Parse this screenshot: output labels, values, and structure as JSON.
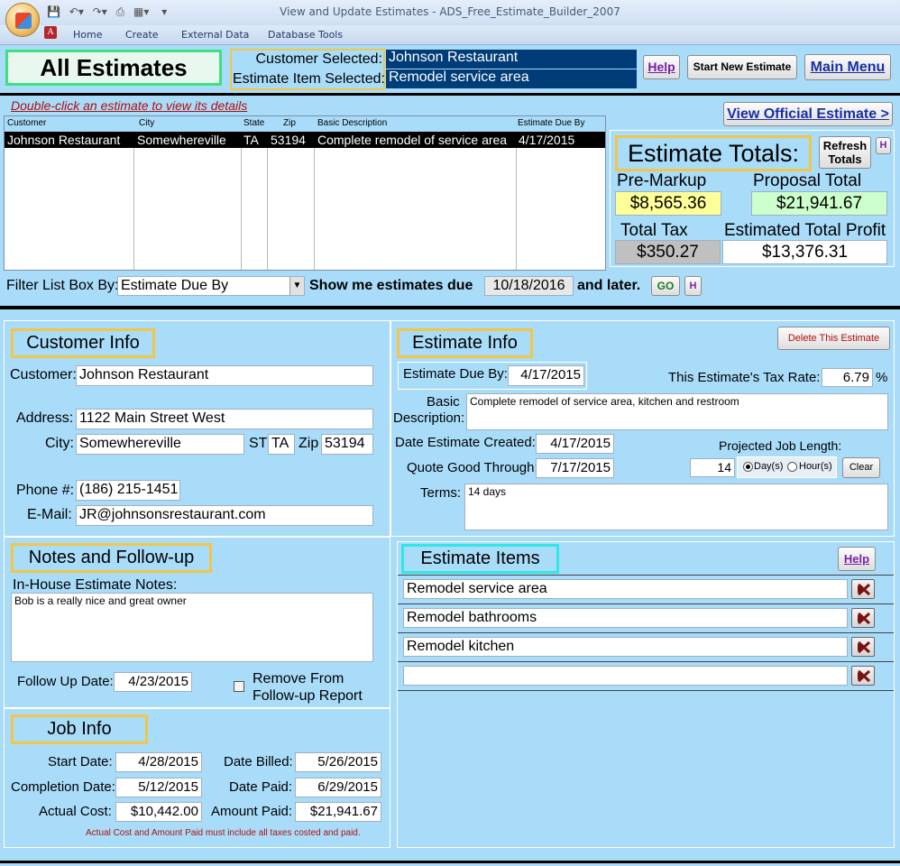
{
  "window": {
    "title": "View and Update Estimates  -  ADS_Free_Estimate_Builder_2007",
    "ribbon_tabs": [
      "Home",
      "Create",
      "External Data",
      "Database Tools"
    ]
  },
  "header": {
    "title": "All Estimates",
    "customer_selected_label": "Customer Selected:",
    "customer_selected_value": "Johnson Restaurant",
    "estimate_item_selected_label": "Estimate Item Selected:",
    "estimate_item_selected_value": "Remodel service area",
    "help_label": "Help",
    "start_new_label": "Start New Estimate",
    "main_menu_label": "Main Menu"
  },
  "list": {
    "hint": "Double-click an estimate to view its details",
    "view_official_label": "View Official Estimate >",
    "columns": [
      "Customer",
      "City",
      "State",
      "Zip",
      "Basic Description",
      "Estimate Due By"
    ],
    "rows": [
      [
        "Johnson Restaurant",
        "Somewhereville",
        "TA",
        "53194",
        "Complete remodel of service area",
        "4/17/2015"
      ]
    ]
  },
  "totals": {
    "title": "Estimate Totals:",
    "refresh_label": "Refresh Totals",
    "h_label": "H",
    "pre_markup_label": "Pre-Markup",
    "pre_markup_value": "$8,565.36",
    "proposal_total_label": "Proposal Total",
    "proposal_total_value": "$21,941.67",
    "total_tax_label": "Total Tax",
    "total_tax_value": "$350.27",
    "profit_label": "Estimated Total Profit",
    "profit_value": "$13,376.31",
    "colors": {
      "pre_markup_bg": "#ffff99",
      "proposal_bg": "#ccffcc",
      "tax_bg": "#c0c0c0"
    }
  },
  "filter": {
    "label": "Filter List Box By:",
    "selected": "Estimate Due By",
    "show_label": "Show me estimates due",
    "date": "10/18/2016",
    "and_later": "and later.",
    "go_label": "GO",
    "h_label": "H"
  },
  "customer_info": {
    "title": "Customer Info",
    "customer_label": "Customer:",
    "customer": "Johnson Restaurant",
    "address_label": "Address:",
    "address": "1122 Main Street West",
    "city_label": "City:",
    "city": "Somewhereville",
    "st_label": "ST",
    "st": "TA",
    "zip_label": "Zip",
    "zip": "53194",
    "phone_label": "Phone #:",
    "phone": "(186) 215-1451",
    "email_label": "E-Mail:",
    "email": "JR@johnsonsrestaurant.com"
  },
  "estimate_info": {
    "title": "Estimate Info",
    "delete_label": "Delete This Estimate",
    "due_by_label": "Estimate Due By:",
    "due_by": "4/17/2015",
    "tax_rate_label": "This Estimate's Tax Rate:",
    "tax_rate": "6.79",
    "percent": "%",
    "basic_label": "Basic",
    "description_label": "Description:",
    "description": "Complete remodel of service area, kitchen and restroom",
    "created_label": "Date Estimate Created:",
    "created": "4/17/2015",
    "good_through_label": "Quote Good Through:",
    "good_through": "7/17/2015",
    "job_length_label": "Projected Job Length:",
    "job_length": "14",
    "days_label": "Day(s)",
    "hours_label": "Hour(s)",
    "clear_label": "Clear",
    "terms_label": "Terms:",
    "terms": "14 days"
  },
  "notes": {
    "title": "Notes and Follow-up",
    "inhouse_label": "In-House Estimate Notes:",
    "inhouse": "Bob is a really nice and great owner",
    "followup_label": "Follow Up Date:",
    "followup": "4/23/2015",
    "remove_label_1": "Remove From",
    "remove_label_2": "Follow-up Report"
  },
  "job_info": {
    "title": "Job Info",
    "start_label": "Start Date:",
    "start": "4/28/2015",
    "billed_label": "Date Billed:",
    "billed": "5/26/2015",
    "completion_label": "Completion Date:",
    "completion": "5/12/2015",
    "paid_label": "Date Paid:",
    "paid": "6/29/2015",
    "cost_label": "Actual Cost:",
    "cost": "$10,442.00",
    "amount_paid_label": "Amount Paid:",
    "amount_paid": "$21,941.67",
    "note": "Actual Cost and Amount Paid must include all taxes costed and paid."
  },
  "estimate_items": {
    "title": "Estimate Items",
    "help_label": "Help",
    "items": [
      "Remodel service area",
      "Remodel bathrooms",
      "Remodel kitchen",
      ""
    ]
  }
}
